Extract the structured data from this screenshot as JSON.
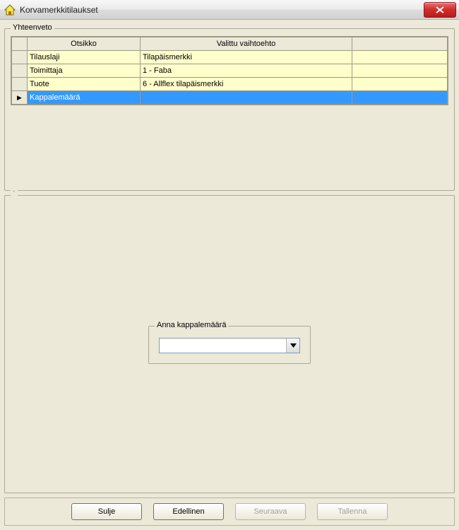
{
  "window": {
    "title": "Korvamerkkitilaukset"
  },
  "summary": {
    "legend": "Yhteenveto",
    "headers": {
      "col1": "Otsikko",
      "col2": "Valittu vaihtoehto"
    },
    "rows": [
      {
        "label": "Tilauslaji",
        "value": "Tilapäismerkki",
        "selected": false
      },
      {
        "label": "Toimittaja",
        "value": "1 - Faba",
        "selected": false
      },
      {
        "label": "Tuote",
        "value": "6 - Allflex tilapäismerkki",
        "selected": false
      },
      {
        "label": "Kappalemäärä",
        "value": "",
        "selected": true
      }
    ]
  },
  "middle": {
    "tick_mark": "`"
  },
  "input_group": {
    "legend": "Anna kappalemäärä",
    "value": ""
  },
  "buttons": {
    "close": "Sulje",
    "prev": "Edellinen",
    "next": "Seuraava",
    "save": "Tallenna"
  }
}
